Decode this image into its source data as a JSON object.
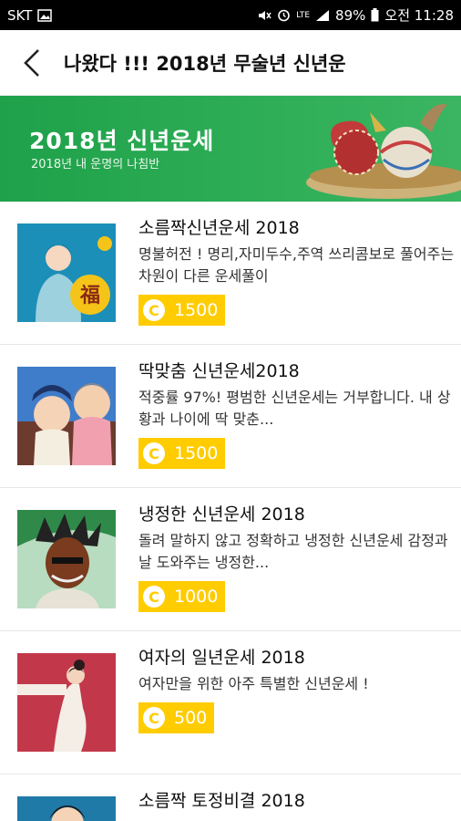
{
  "statusbar": {
    "carrier": "SKT",
    "signal_label": "LTE",
    "battery": "89%",
    "time": "오전 11:28"
  },
  "appbar": {
    "title": "나왔다 !!! 2018년 무술년 신년운"
  },
  "banner": {
    "title": "2018년 신년운세",
    "subtitle": "2018년 내 운명의 나침반"
  },
  "items": [
    {
      "name": "소름짝신년운세 2018",
      "desc": "명불허전 ! 명리,자미두수,주역 쓰리콤보로 풀어주는 차원이 다른  운세풀이",
      "price": "1500"
    },
    {
      "name": "딱맞춤 신년운세2018",
      "desc": "적중률 97%! 평범한 신년운세는 거부합니다.  내 상황과 나이에 딱 맞춘...",
      "price": "1500"
    },
    {
      "name": "냉정한 신년운세 2018",
      "desc": "돌려 말하지 않고 정확하고 냉정한 신년운세 감정과 날 도와주는 냉정한...",
      "price": "1000"
    },
    {
      "name": "여자의 일년운세 2018",
      "desc": "여자만을 위한 아주 특별한 신년운세 !",
      "price": "500"
    },
    {
      "name": "소름짝 토정비결 2018",
      "desc": "",
      "price": ""
    }
  ],
  "coin_symbol": "C",
  "thumb_text": "福"
}
